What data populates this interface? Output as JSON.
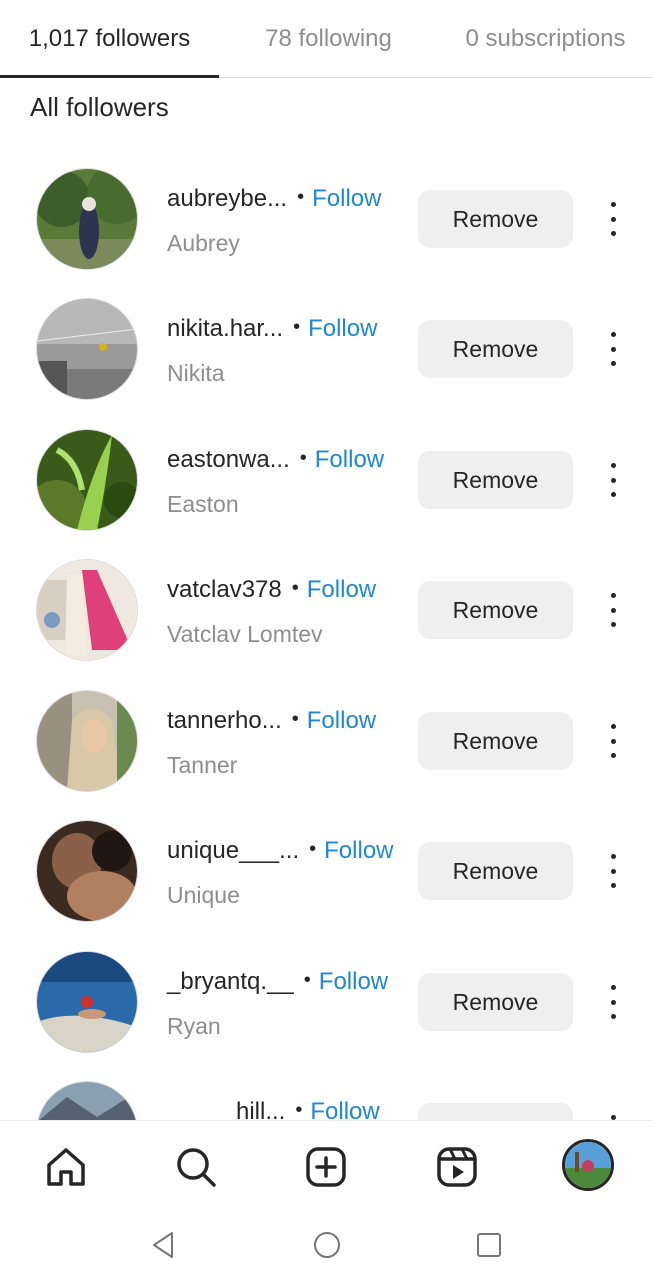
{
  "tabs": [
    {
      "label": "1,017 followers",
      "active": true
    },
    {
      "label": "78 following",
      "active": false
    },
    {
      "label": "0 subscriptions",
      "active": false
    }
  ],
  "section_title": "All followers",
  "followers": [
    {
      "handle": "aubreybe...",
      "name": "Aubrey",
      "follow_label": "Follow",
      "remove_label": "Remove"
    },
    {
      "handle": "nikita.har...",
      "name": "Nikita",
      "follow_label": "Follow",
      "remove_label": "Remove"
    },
    {
      "handle": "eastonwa...",
      "name": "Easton",
      "follow_label": "Follow",
      "remove_label": "Remove"
    },
    {
      "handle": "vatclav378",
      "name": "Vatclav Lomtev",
      "follow_label": "Follow",
      "remove_label": "Remove"
    },
    {
      "handle": "tannerho...",
      "name": "Tanner",
      "follow_label": "Follow",
      "remove_label": "Remove"
    },
    {
      "handle": "unique___...",
      "name": "Unique",
      "follow_label": "Follow",
      "remove_label": "Remove"
    },
    {
      "handle": "_bryantq.__",
      "name": "Ryan",
      "follow_label": "Follow",
      "remove_label": "Remove"
    },
    {
      "handle": "hill...",
      "name": "",
      "follow_label": "Follow",
      "remove_label": ""
    }
  ],
  "separator": "•",
  "nav": [
    "home-icon",
    "search-icon",
    "create-icon",
    "reels-icon",
    "profile-avatar"
  ],
  "system_nav": [
    "back-icon",
    "home-circle-icon",
    "recents-icon"
  ],
  "colors": {
    "follow": "#1e88d8",
    "text": "#262626",
    "muted": "#8e8e8e",
    "button_bg": "#efefef"
  }
}
